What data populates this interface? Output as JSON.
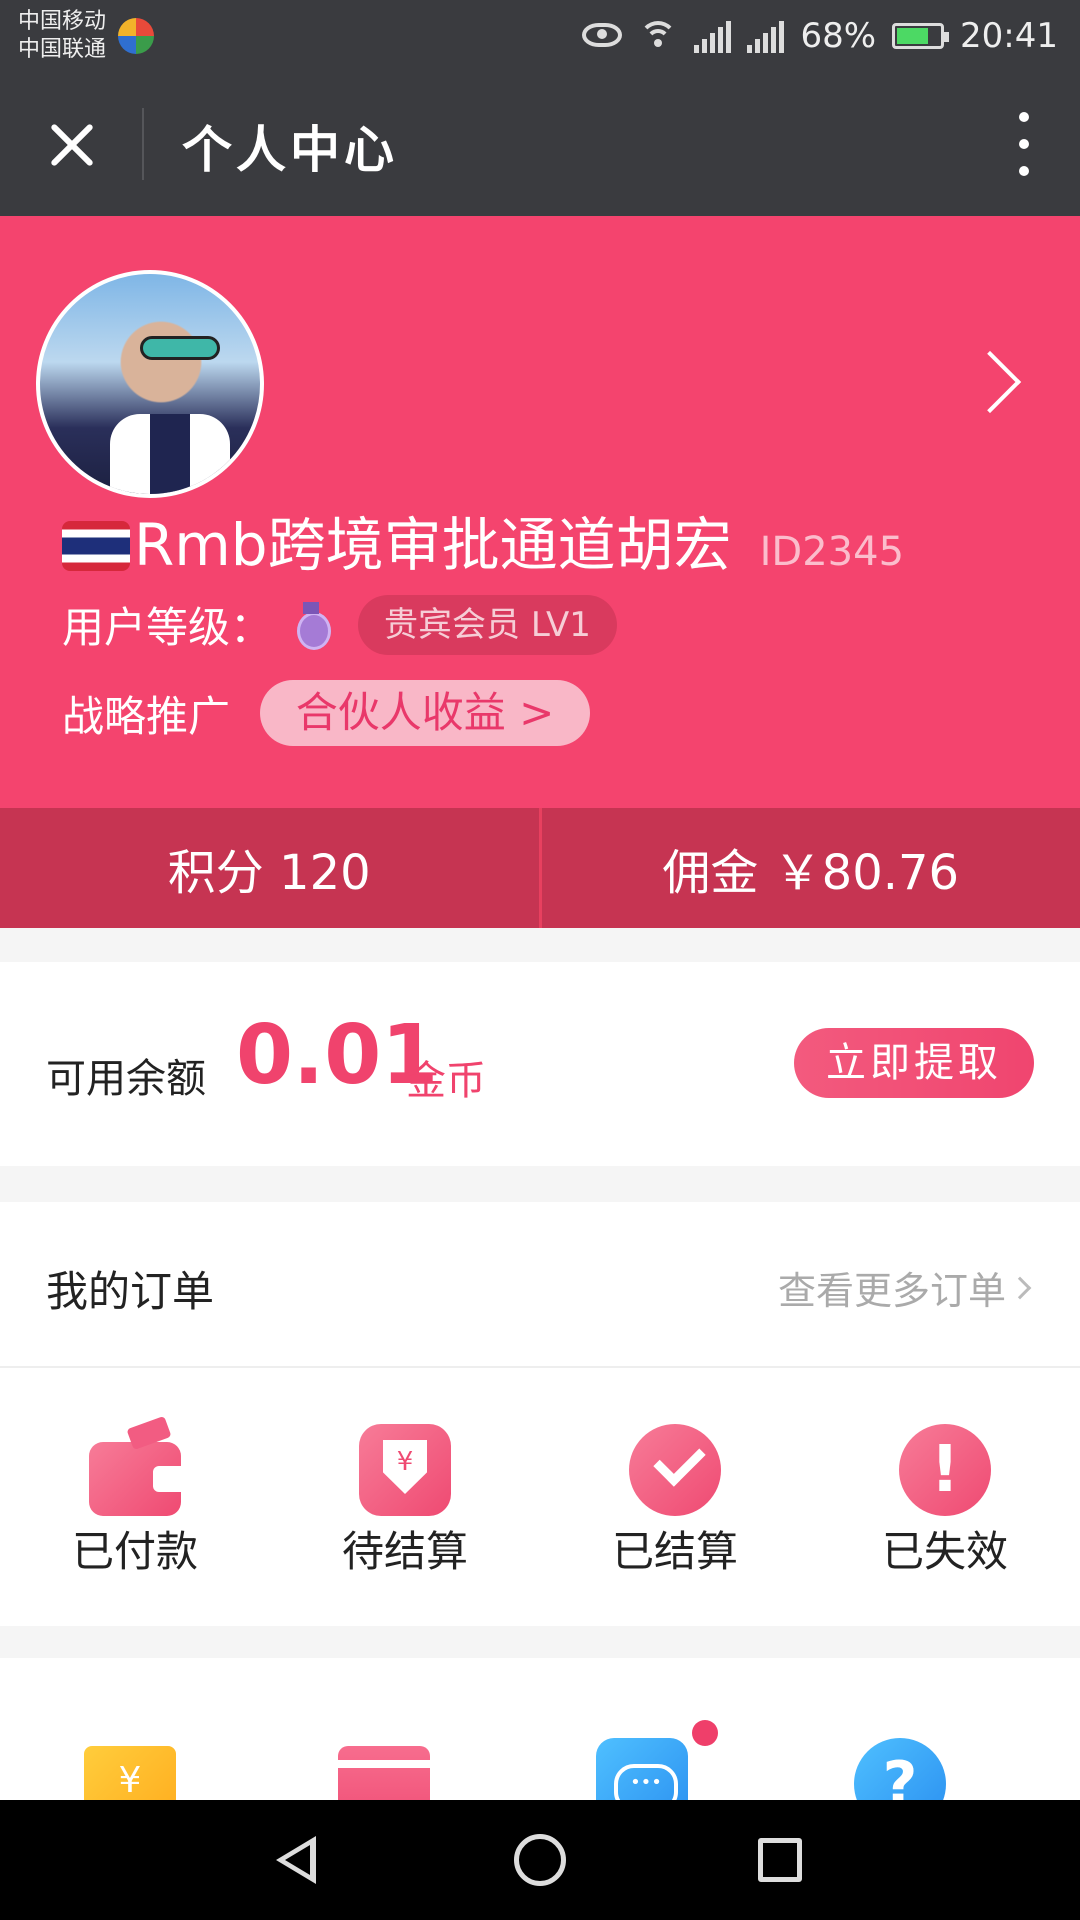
{
  "status_bar": {
    "carrier_1": "中国移动",
    "carrier_2": "中国联通",
    "battery": "68%",
    "time": "20:41"
  },
  "title_bar": {
    "title": "个人中心"
  },
  "profile": {
    "username": "Rmb跨境审批通道胡宏",
    "user_id": "ID2345",
    "level_label": "用户等级：",
    "level_badge": "贵宾会员 LV1",
    "promo_label": "战略推广",
    "partner_button": "合伙人收益 >"
  },
  "stats": {
    "points": "积分 120",
    "commission": "佣金 ￥80.76"
  },
  "balance": {
    "label": "可用余额",
    "value": "0.01",
    "unit": "金币",
    "withdraw_button": "立即提取"
  },
  "orders": {
    "title": "我的订单",
    "more_link": "查看更多订单",
    "items": [
      {
        "label": "已付款",
        "icon": "wallet-icon"
      },
      {
        "label": "待结算",
        "icon": "pending-settlement-icon"
      },
      {
        "label": "已结算",
        "icon": "checkmark-icon"
      },
      {
        "label": "已失效",
        "icon": "exclamation-icon"
      }
    ]
  },
  "tools": {
    "icons": [
      "coupon-icon",
      "shop-icon",
      "chat-icon",
      "help-icon"
    ],
    "coupon_glyph": "¥",
    "help_glyph": "?"
  },
  "colors": {
    "brand_pink": "#f4446e",
    "stats_bar": "#c63452",
    "dark_header": "#3a3b3f"
  }
}
